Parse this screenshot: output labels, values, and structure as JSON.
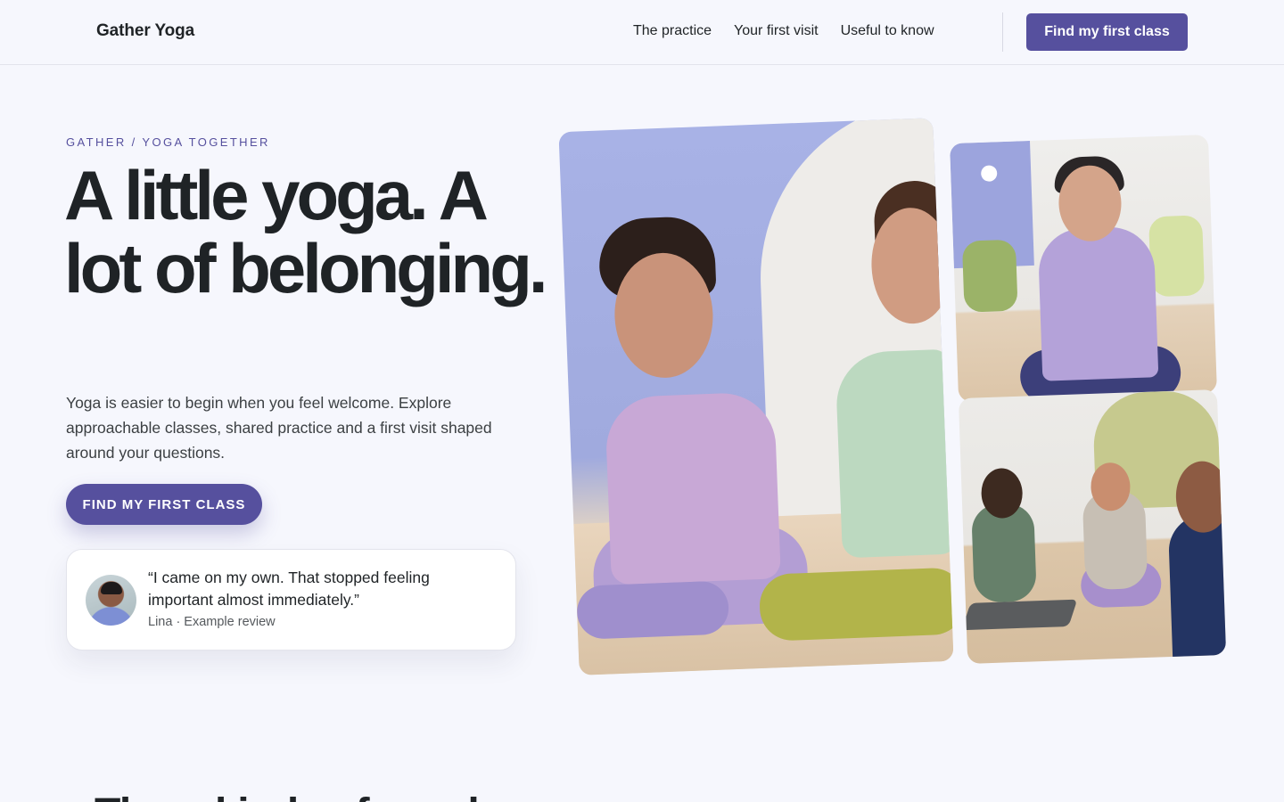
{
  "header": {
    "brand": "Gather Yoga",
    "nav": [
      "The practice",
      "Your first visit",
      "Useful to know"
    ],
    "cta_label": "Find my first class"
  },
  "hero": {
    "eyebrow": "GATHER / YOGA TOGETHER",
    "headline": "A little yoga. A lot of belonging.",
    "lede": "Yoga is easier to begin when you feel welcome. Explore approachable classes, shared practice and a first visit shaped around your questions.",
    "cta_label": "FIND MY FIRST CLASS",
    "review": {
      "quote": "“I came on my own. That stopped feeling important almost immediately.”",
      "attribution": "Lina · Example review"
    }
  },
  "next_section": {
    "heading": "Three kinds of good"
  },
  "colors": {
    "accent": "#56509e",
    "background": "#f6f7fd",
    "text": "#1f2326"
  }
}
